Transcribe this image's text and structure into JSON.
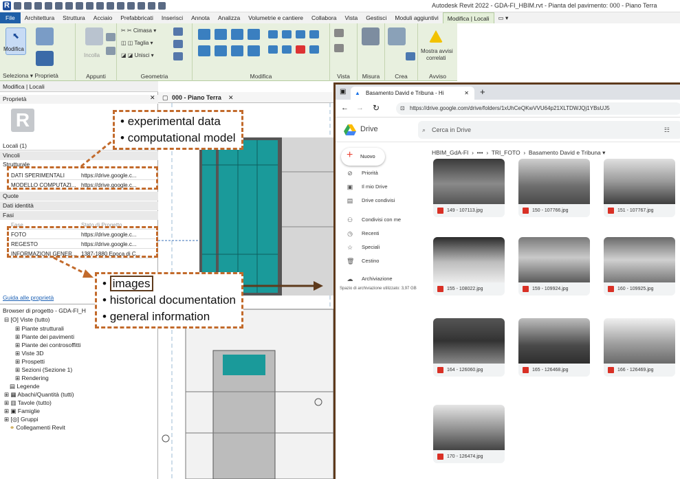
{
  "app": {
    "title": "Autodesk Revit 2022 - GDA-FI_HBIM.rvt - Pianta del pavimento: 000 - Piano Terra"
  },
  "ribbon_tabs": [
    "File",
    "Architettura",
    "Struttura",
    "Acciaio",
    "Prefabbricati",
    "Inserisci",
    "Annota",
    "Analizza",
    "Volumetrie e cantiere",
    "Collabora",
    "Vista",
    "Gestisci",
    "Moduli aggiuntivi",
    "Modifica | Locali"
  ],
  "ribbon": {
    "modify_label": "Modifica",
    "incolla_label": "Incolla",
    "cimasa": "Cimasa",
    "taglia": "Taglia",
    "unisci": "Unisci",
    "mostra_avvisi": "Mostra avvisi",
    "correlati": "correlati",
    "groups": {
      "seleziona": "Seleziona",
      "proprieta": "Proprietà",
      "appunti": "Appunti",
      "geometria": "Geometria",
      "modifica": "Modifica",
      "vista": "Vista",
      "misura": "Misura",
      "crea": "Crea",
      "avviso": "Avviso"
    }
  },
  "modify_bar": "Modifica | Locali",
  "properties": {
    "title": "Proprietà",
    "type_selector": "Locali (1)",
    "sections": {
      "vincoli": "Vincoli",
      "strutturale": "Strutturale",
      "quote": "Quote",
      "dati_identita": "Dati identità",
      "fasi": "Fasi"
    },
    "rows_top": [
      {
        "key": "DATI SPERIMENTALI",
        "value": "https://drive.google.c..."
      },
      {
        "key": "MODELLO COMPUTAZI...",
        "value": "https://drive.google.c..."
      }
    ],
    "fase": {
      "key": "Fase",
      "value": "Stato di Progetto"
    },
    "rows_bottom": [
      {
        "key": "FOTO",
        "value": "https://drive.google.c..."
      },
      {
        "key": "REGESTO",
        "value": "https://drive.google.c..."
      },
      {
        "key": "INFORMAZIONI GENER...",
        "value": "1387-1880 Epoca di C..."
      }
    ],
    "help_link": "Guida alle proprietà"
  },
  "project_browser": {
    "title": "Browser di progetto - GDA-FI_H",
    "root": "Viste (tutto)",
    "items": [
      "Piante strutturali",
      "Piante dei pavimenti",
      "Piante dei controsoffitti",
      "Viste 3D",
      "Prospetti",
      "Sezioni (Sezione 1)",
      "Rendering"
    ],
    "top_items": [
      "Legende",
      "Abachi/Quantità (tutti)",
      "Tavole (tutto)",
      "Famiglie",
      "Gruppi",
      "Collegamenti Revit"
    ]
  },
  "view_tab": "000 - Piano Terra",
  "browser": {
    "tab_title": "Basamento David e Tribuna - Hi",
    "url": "https://drive.google.com/drive/folders/1xUhCeQKwVVU64p21XLTDWJQj1YBsUJ5",
    "drive_label": "Drive",
    "search_placeholder": "Cerca in Drive",
    "new_button": "Nuovo",
    "nav": [
      "Priorità",
      "Il mio Drive",
      "Drive condivisi",
      "Condivisi con me",
      "Recenti",
      "Speciali",
      "Cestino",
      "Archiviazione"
    ],
    "storage": "Spazio di archiviazione utilizzato: 3,97 GB",
    "breadcrumb": [
      "HBIM_GdA-FI",
      "•••",
      "TRI_FOTO",
      "Basamento David e Tribuna"
    ],
    "files": [
      "149 - 107113.jpg",
      "150 - 107766.jpg",
      "151 - 107767.jpg",
      "155 - 108022.jpg",
      "159 - 109924.jpg",
      "160 - 109925.jpg",
      "164 - 126060.jpg",
      "165 - 126468.jpg",
      "166 - 126469.jpg",
      "170 - 126474.jpg"
    ]
  },
  "callouts": {
    "top": [
      "experimental data",
      "computational model"
    ],
    "bottom": [
      "images",
      "historical documentation",
      "general information"
    ]
  },
  "colors": {
    "revit_blue": "#1f5fa8",
    "ribbon_green": "#e8f0df",
    "room_teal": "#1a9a9a",
    "callout_orange": "#c26a2b",
    "arrow_brown": "#5e3a1c",
    "jpg_red": "#d93025"
  }
}
